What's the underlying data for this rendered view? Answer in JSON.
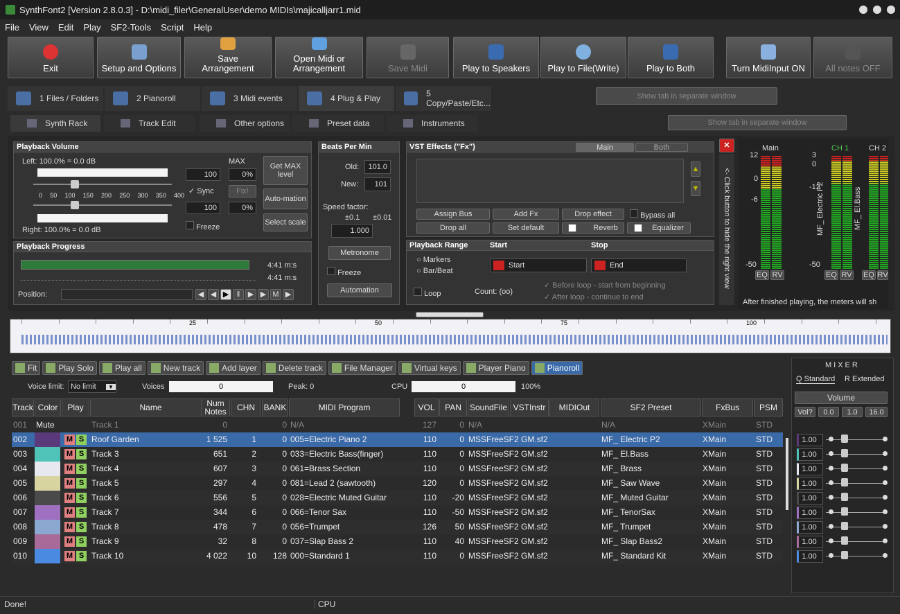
{
  "window": {
    "title": "SynthFont2 [Version 2.8.0.3] - D:\\midi_filer\\GeneralUser\\demo MIDIs\\majicalljarr1.mid"
  },
  "menu": [
    "File",
    "View",
    "Edit",
    "Play",
    "SF2-Tools",
    "Script",
    "Help"
  ],
  "toolbar": {
    "exit": "Exit",
    "setup": "Setup and Options",
    "save_arr": "Save Arrangement",
    "open_midi": "Open Midi or Arrangement",
    "save_midi": "Save Midi",
    "play_speakers": "Play to Speakers",
    "play_file": "Play to File(Write)",
    "play_both": "Play to Both",
    "turn_midi": "Turn MidiInput ON",
    "all_notes": "All notes OFF"
  },
  "tabs": [
    "1 Files / Folders",
    "2 Pianoroll",
    "3 Midi events",
    "4 Plug & Play",
    "5 Copy/Paste/Etc..."
  ],
  "show_tab_window": "Show tab in separate window",
  "subtabs": [
    "Synth Rack",
    "Track Edit",
    "Other options",
    "Preset data",
    "Instruments"
  ],
  "playback_volume": {
    "title": "Playback Volume",
    "left": "Left: 100.0% = 0.0 dB",
    "right": "Right: 100.0% = 0.0 dB",
    "max": "MAX",
    "val1": "100",
    "val2": "100",
    "pct1": "0%",
    "pct2": "0%",
    "sync": "Sync",
    "fix": "Fix!",
    "freeze": "Freeze",
    "get_max": "Get MAX level",
    "automation": "Auto-mation",
    "select_scale": "Select scale",
    "scale": [
      "0",
      "50",
      "100",
      "150",
      "200",
      "250",
      "300",
      "350",
      "400"
    ]
  },
  "beats": {
    "title": "Beats Per Min",
    "old_label": "Old:",
    "old": "101.0",
    "new_label": "New:",
    "new": "101",
    "speed": "Speed factor:",
    "p1": "±0.1",
    "p2": "±0.01",
    "factor": "1.000",
    "metronome": "Metronome",
    "freeze": "Freeze",
    "automation": "Automation"
  },
  "vst": {
    "title": "VST Effects (\"Fx\")",
    "main": "Main",
    "both": "Both",
    "assign_bus": "Assign Bus",
    "add_fx": "Add Fx",
    "drop_effect": "Drop effect",
    "bypass_all": "Bypass all",
    "drop_all": "Drop all",
    "set_default": "Set default",
    "reverb": "Reverb",
    "equalizer": "Equalizer"
  },
  "progress": {
    "title": "Playback Progress",
    "t1": "4:41 m:s",
    "t2": "4:41 m:s",
    "position": "Position:"
  },
  "range": {
    "title": "Playback Range",
    "start": "Start",
    "stop": "Stop",
    "markers": "Markers",
    "barbeat": "Bar/Beat",
    "start_val": "Start",
    "end_val": "End",
    "loop": "Loop",
    "count": "Count: (oo)",
    "before": "Before loop - start from beginning",
    "after": "After loop - continue to end"
  },
  "hide_right": "<- Click button to hide the right view",
  "meters": {
    "main": "Main",
    "ch1": "CH 1",
    "ch2": "CH 2",
    "s12": "12",
    "s0": "0",
    "s_6": "-6",
    "s_50": "-50",
    "c3": "3",
    "c0": "0",
    "c_12": "-12",
    "c_50": "-50",
    "eq": "EQ",
    "rv": "RV",
    "ch1_name": "MF_ Electric P2",
    "ch2_name": "MF_ El.Bass",
    "note": "After finished playing, the meters will sh"
  },
  "ruler": [
    "25",
    "50",
    "75",
    "100"
  ],
  "tracktools": [
    "Fit",
    "Play Solo",
    "Play all",
    "New track",
    "Add layer",
    "Delete track",
    "File Manager",
    "Virtual keys",
    "Player Piano",
    "Pianoroll"
  ],
  "voice": {
    "limit_label": "Voice limit:",
    "limit": "No limit",
    "voices": "Voices",
    "voices_val": "0",
    "peak": "Peak: 0",
    "cpu": "CPU",
    "cpu_val": "0",
    "cpu_pct": "100%"
  },
  "columns": [
    "Track",
    "Color",
    "Play",
    "Name",
    "Num Notes",
    "CHN",
    "BANK",
    "MIDI Program",
    "VOL",
    "PAN",
    "SoundFile",
    "VSTInstr",
    "MIDIOut",
    "SF2 Preset",
    "FxBus",
    "PSM"
  ],
  "tracks": [
    {
      "id": "001",
      "color": "#2b2b2b",
      "mute": "Mute",
      "name": "Track 1",
      "notes": "0",
      "chn": "",
      "bank": "0",
      "prog": "N/A",
      "vol": "127",
      "pan": "0",
      "sf": "N/A",
      "preset": "N/A",
      "bus": "XMain",
      "psm": "STD"
    },
    {
      "id": "002",
      "color": "#5a3a7a",
      "name": "Roof Garden",
      "notes": "1 525",
      "chn": "1",
      "bank": "0",
      "prog": "005=Electric Piano 2",
      "vol": "110",
      "pan": "0",
      "sf": "MSSFreeSF2 GM.sf2",
      "preset": "MF_ Electric P2",
      "bus": "XMain",
      "psm": "STD"
    },
    {
      "id": "003",
      "color": "#4fc3b8",
      "name": "Track 3",
      "notes": "651",
      "chn": "2",
      "bank": "0",
      "prog": "033=Electric Bass(finger)",
      "vol": "110",
      "pan": "0",
      "sf": "MSSFreeSF2 GM.sf2",
      "preset": "MF_ El.Bass",
      "bus": "XMain",
      "psm": "STD"
    },
    {
      "id": "004",
      "color": "#e8e8f0",
      "name": "Track 4",
      "notes": "607",
      "chn": "3",
      "bank": "0",
      "prog": "061=Brass Section",
      "vol": "110",
      "pan": "0",
      "sf": "MSSFreeSF2 GM.sf2",
      "preset": "MF_ Brass",
      "bus": "XMain",
      "psm": "STD"
    },
    {
      "id": "005",
      "color": "#d8d4a0",
      "name": "Track 5",
      "notes": "297",
      "chn": "4",
      "bank": "0",
      "prog": "081=Lead 2 (sawtooth)",
      "vol": "120",
      "pan": "0",
      "sf": "MSSFreeSF2 GM.sf2",
      "preset": "MF_ Saw Wave",
      "bus": "XMain",
      "psm": "STD"
    },
    {
      "id": "006",
      "color": "#4a4a4a",
      "name": "Track 6",
      "notes": "556",
      "chn": "5",
      "bank": "0",
      "prog": "028=Electric Muted Guitar",
      "vol": "110",
      "pan": "-20",
      "sf": "MSSFreeSF2 GM.sf2",
      "preset": "MF_ Muted Guitar",
      "bus": "XMain",
      "psm": "STD"
    },
    {
      "id": "007",
      "color": "#a070c0",
      "name": "Track 7",
      "notes": "344",
      "chn": "6",
      "bank": "0",
      "prog": "066=Tenor Sax",
      "vol": "110",
      "pan": "-50",
      "sf": "MSSFreeSF2 GM.sf2",
      "preset": "MF_ TenorSax",
      "bus": "XMain",
      "psm": "STD"
    },
    {
      "id": "008",
      "color": "#8aa8d0",
      "name": "Track 8",
      "notes": "478",
      "chn": "7",
      "bank": "0",
      "prog": "056=Trumpet",
      "vol": "126",
      "pan": "50",
      "sf": "MSSFreeSF2 GM.sf2",
      "preset": "MF_ Trumpet",
      "bus": "XMain",
      "psm": "STD"
    },
    {
      "id": "009",
      "color": "#a86a98",
      "name": "Track 9",
      "notes": "32",
      "chn": "8",
      "bank": "0",
      "prog": "037=Slap Bass 2",
      "vol": "110",
      "pan": "40",
      "sf": "MSSFreeSF2 GM.sf2",
      "preset": "MF_ Slap Bass2",
      "bus": "XMain",
      "psm": "STD"
    },
    {
      "id": "010",
      "color": "#4a8ae0",
      "name": "Track 10",
      "notes": "4 022",
      "chn": "10",
      "bank": "128",
      "prog": "000=Standard 1",
      "vol": "110",
      "pan": "0",
      "sf": "MSSFreeSF2 GM.sf2",
      "preset": "MF_ Standard Kit",
      "bus": "XMain",
      "psm": "STD"
    }
  ],
  "mixer": {
    "title": "MIXER",
    "standard": "Q Standard",
    "extended": "R Extended",
    "volume": "Volume",
    "vq": "Vol?",
    "v0": "0.0",
    "v1": "1.0",
    "v16": "16.0",
    "rows": [
      "1.00",
      "1.00",
      "1.00",
      "1.00",
      "1.00",
      "1.00",
      "1.00",
      "1.00",
      "1.00"
    ]
  },
  "status": {
    "left": "Done!",
    "cpu": "CPU"
  }
}
